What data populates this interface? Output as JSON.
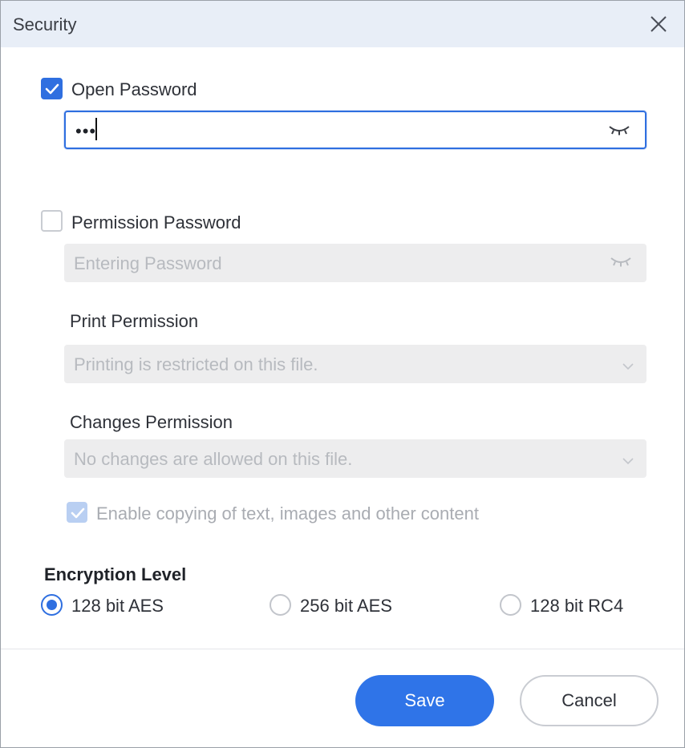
{
  "window": {
    "title": "Security"
  },
  "open_password": {
    "label": "Open Password",
    "checked": true,
    "value": "•••"
  },
  "permission_password": {
    "label": "Permission Password",
    "checked": false,
    "placeholder": "Entering Password"
  },
  "print_permission": {
    "label": "Print Permission",
    "selected": "Printing is restricted on this file."
  },
  "changes_permission": {
    "label": "Changes Permission",
    "selected": "No changes are allowed on this file."
  },
  "copy_option": {
    "label": "Enable copying of text, images and other content",
    "checked": true,
    "disabled": true
  },
  "encryption": {
    "label": "Encryption Level",
    "options": [
      {
        "label": "128 bit AES",
        "selected": true
      },
      {
        "label": "256 bit AES",
        "selected": false
      },
      {
        "label": "128 bit RC4",
        "selected": false
      }
    ]
  },
  "footer": {
    "save_label": "Save",
    "cancel_label": "Cancel"
  },
  "colors": {
    "accent": "#2f74e8",
    "titlebar": "#e8eef7",
    "disabled_field": "#ededee"
  }
}
